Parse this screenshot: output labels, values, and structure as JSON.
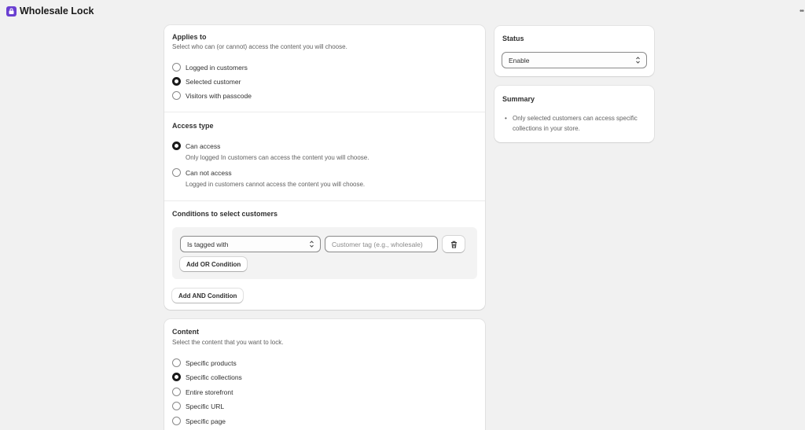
{
  "app": {
    "title": "Wholesale Lock"
  },
  "applies_to": {
    "title": "Applies to",
    "subtitle": "Select who can (or cannot) access the content you will choose.",
    "options": [
      {
        "label": "Logged in customers",
        "selected": false
      },
      {
        "label": "Selected customer",
        "selected": true
      },
      {
        "label": "Visitors with passcode",
        "selected": false
      }
    ]
  },
  "access_type": {
    "title": "Access type",
    "options": [
      {
        "label": "Can access",
        "help": "Only logged In customers can access the content you will choose.",
        "selected": true
      },
      {
        "label": "Can not access",
        "help": "Logged in customers cannot access the content you will choose.",
        "selected": false
      }
    ]
  },
  "conditions": {
    "title": "Conditions to select customers",
    "condition_select": "Is tagged with",
    "tag_placeholder": "Customer tag (e.g., wholesale)",
    "add_or_label": "Add OR Condition",
    "add_and_label": "Add AND Condition"
  },
  "content": {
    "title": "Content",
    "subtitle": "Select the content that you want to lock.",
    "options": [
      {
        "label": "Specific products",
        "selected": false
      },
      {
        "label": "Specific collections",
        "selected": true
      },
      {
        "label": "Entire storefront",
        "selected": false
      },
      {
        "label": "Specific URL",
        "selected": false
      },
      {
        "label": "Specific page",
        "selected": false
      }
    ]
  },
  "status": {
    "title": "Status",
    "value": "Enable"
  },
  "summary": {
    "title": "Summary",
    "items": [
      "Only selected customers can access specific collections in your store."
    ]
  },
  "icons": {
    "logo": "app-logo-icon",
    "more": "more-horizontal-icon",
    "delete": "trash-icon",
    "chevron": "select-chevron-icon"
  }
}
